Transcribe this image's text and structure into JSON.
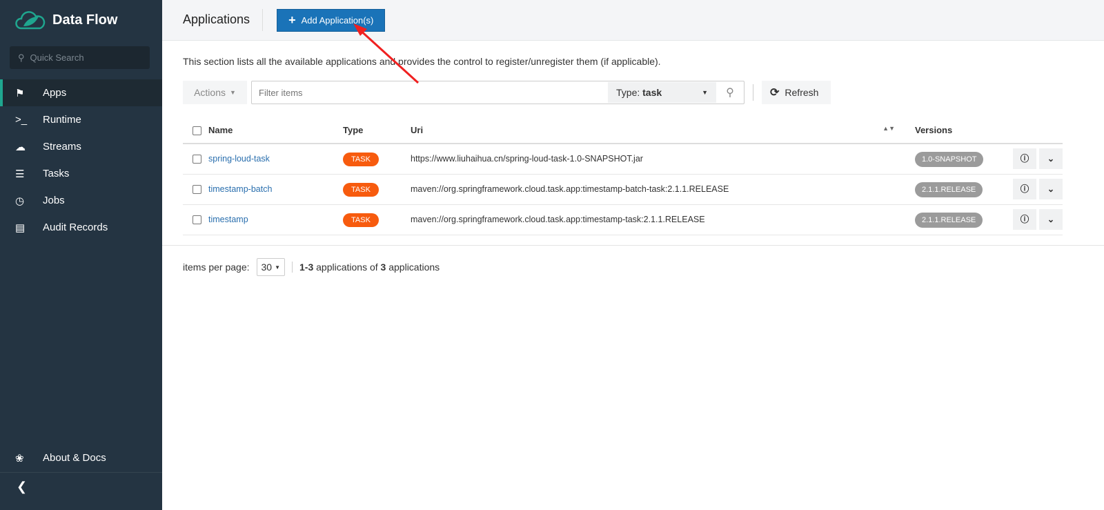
{
  "sidebar": {
    "title": "Data Flow",
    "search_placeholder": "Quick Search",
    "items": [
      {
        "label": "Apps",
        "icon": "tags-icon"
      },
      {
        "label": "Runtime",
        "icon": "terminal-icon"
      },
      {
        "label": "Streams",
        "icon": "cloud-icon"
      },
      {
        "label": "Tasks",
        "icon": "server-icon"
      },
      {
        "label": "Jobs",
        "icon": "clock-icon"
      },
      {
        "label": "Audit Records",
        "icon": "list-icon"
      }
    ],
    "about": "About & Docs"
  },
  "header": {
    "title": "Applications",
    "add_button": "Add Application(s)"
  },
  "description": "This section lists all the available applications and provides the control to register/unregister them (if applicable).",
  "toolbar": {
    "actions": "Actions",
    "filter_placeholder": "Filter items",
    "type_label": "Type:",
    "type_value": "task",
    "refresh": "Refresh"
  },
  "table": {
    "headers": {
      "name": "Name",
      "type": "Type",
      "uri": "Uri",
      "versions": "Versions"
    },
    "rows": [
      {
        "name": "spring-loud-task",
        "type": "TASK",
        "uri": "https://www.liuhaihua.cn/spring-loud-task-1.0-SNAPSHOT.jar",
        "version": "1.0-SNAPSHOT"
      },
      {
        "name": "timestamp-batch",
        "type": "TASK",
        "uri": "maven://org.springframework.cloud.task.app:timestamp-batch-task:2.1.1.RELEASE",
        "version": "2.1.1.RELEASE"
      },
      {
        "name": "timestamp",
        "type": "TASK",
        "uri": "maven://org.springframework.cloud.task.app:timestamp-task:2.1.1.RELEASE",
        "version": "2.1.1.RELEASE"
      }
    ]
  },
  "pagination": {
    "label": "items per page:",
    "per_page": "30",
    "range": "1-3",
    "mid": "applications of",
    "total": "3",
    "suffix": "applications"
  }
}
